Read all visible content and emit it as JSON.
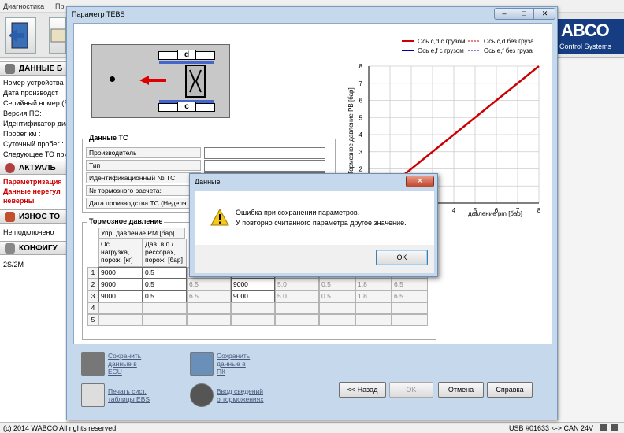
{
  "menu": {
    "items": [
      "Диагностика",
      "Пр"
    ]
  },
  "left_panel": {
    "device_section": "ДАННЫЕ Б",
    "device_rows": [
      "Номер устройства :",
      "Дата производст",
      "Серийный номер (Е",
      "Версия ПО:",
      "Идентификатор диа",
      "Пробег км :",
      "Суточный пробег :",
      "Следующее ТО при"
    ],
    "actual_section": "АКТУАЛЬ",
    "actual_rows": [
      "Параметризация",
      "Данные нерегул",
      "неверны"
    ],
    "wear_section": "ИЗНОС ТО",
    "wear_row": "Не подключено",
    "config_section": "КОНФИГУ",
    "config_row": "2S/2M"
  },
  "logo": {
    "brand": "ABCO",
    "subtitle": "Control Systems"
  },
  "status": {
    "copyright": "(c) 2014 WABCO All rights reserved",
    "connection": "USB #01633 <-> CAN 24V"
  },
  "tebs": {
    "title": "Параметр TEBS",
    "window_buttons": {
      "minimize": "–",
      "maximize": "□",
      "close": "✕"
    },
    "axle_labels": {
      "top": "d",
      "bottom": "c"
    },
    "vehicle": {
      "section": "Данные ТС",
      "fields": [
        {
          "label": "Производитель",
          "value": ""
        },
        {
          "label": "Тип",
          "value": ""
        },
        {
          "label": "Идентификационный № ТС",
          "value": ""
        },
        {
          "label": "№ тормозного расчета:",
          "value": ""
        },
        {
          "label": "Дата производства ТС (Неделя",
          "value": ""
        }
      ]
    },
    "brake": {
      "section": "Тормозное давление",
      "pm_header": "Упр. давление PM [бар]",
      "col_headers": [
        "Ос. нагрузка, порож. [кг]",
        "Дав. в п./рессорах, порож. [бар]"
      ],
      "row_numbers": [
        "1",
        "2",
        "3",
        "4",
        "5"
      ],
      "rows": [
        [
          "9000",
          "0.5",
          "",
          "",
          "",
          "",
          "",
          ""
        ],
        [
          "9000",
          "0.5",
          "6.5",
          "9000",
          "5.0",
          "0.5",
          "1.8",
          "6.5"
        ],
        [
          "9000",
          "0.5",
          "6.5",
          "9000",
          "5.0",
          "0.5",
          "1.8",
          "6.5"
        ],
        [
          "",
          "",
          "",
          "",
          "",
          "",
          "",
          ""
        ],
        [
          "",
          "",
          "",
          "",
          "",
          "",
          "",
          ""
        ]
      ]
    },
    "actions": {
      "save_ecu": [
        "Сохранить",
        "данные в",
        "ECU"
      ],
      "save_pc": [
        "Сохранить",
        "данные в",
        "ПК"
      ],
      "print": [
        "Печать сист.",
        "таблицы EBS"
      ],
      "brakes_info": [
        "Ввод сведений",
        "о торможениях"
      ]
    },
    "nav": {
      "back": "<< Назад",
      "ok": "OK",
      "cancel": "Отмена",
      "help": "Справка"
    }
  },
  "chart_data": {
    "type": "line",
    "ylabel": "Тормозное давление РВ [бар]",
    "xlabel": "давление pm [бар]",
    "x_ticks": [
      "4",
      "5",
      "6",
      "7",
      "8"
    ],
    "y_ticks": [
      "0",
      "1",
      "2",
      "3",
      "4",
      "5",
      "6",
      "7",
      "8"
    ],
    "xlim": [
      0,
      8
    ],
    "ylim": [
      0,
      8
    ],
    "grid": true,
    "legend": [
      "Ось c,d с грузом",
      "Ось c,d без груза",
      "Ось e,f с грузом",
      "Ось e,f без груза"
    ],
    "legend_position": "top",
    "series": [
      {
        "name": "Ось c,d с грузом",
        "color": "#cc0000",
        "style": "solid",
        "x": [
          0.5,
          8
        ],
        "y": [
          0.5,
          8
        ]
      },
      {
        "name": "Ось c,d без груза",
        "color": "#cc0000",
        "style": "dashed",
        "x": [],
        "y": []
      },
      {
        "name": "Ось e,f с грузом",
        "color": "#0000aa",
        "style": "solid",
        "x": [],
        "y": []
      },
      {
        "name": "Ось e,f без груза",
        "color": "#0000aa",
        "style": "dashed",
        "x": [],
        "y": []
      }
    ]
  },
  "dialog": {
    "title": "Данные",
    "message_lines": [
      "Ошибка при сохранении параметров.",
      "У повторно считанного параметра другое значение."
    ],
    "ok": "OK",
    "close": "✕"
  }
}
